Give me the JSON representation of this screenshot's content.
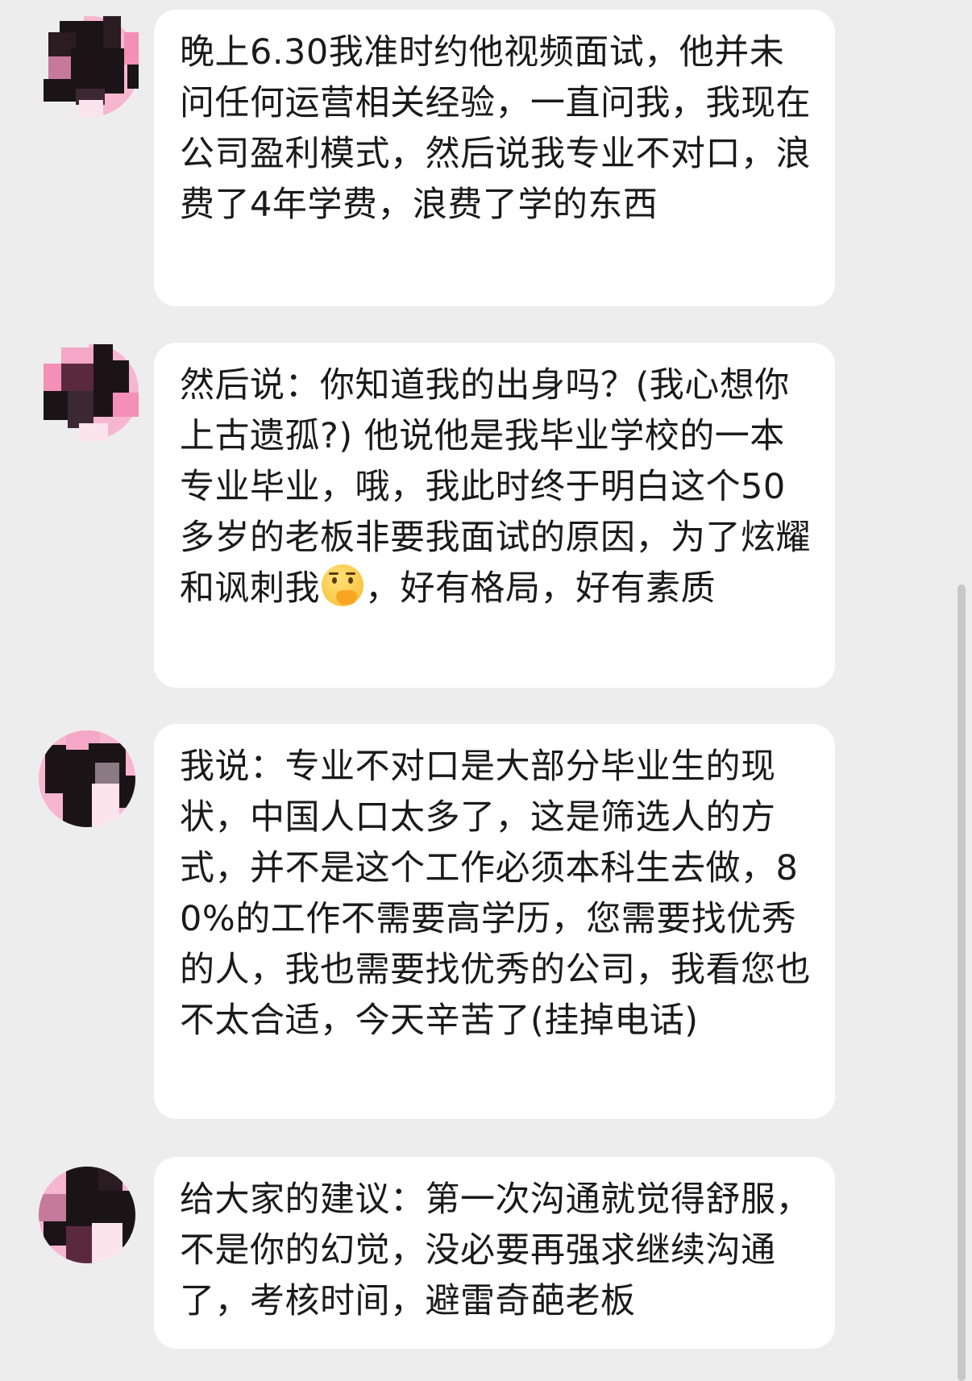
{
  "messages": [
    {
      "part1": "晚上6.30我准时约他视频面试，他并未问任何运营相关经验，一直问我，我现在公司盈利模式，然后说我专业不对口，浪费了4年学费，浪费了学的东西"
    },
    {
      "part1": "然后说：你知道我的出身吗？(我心想你上古遗孤?) 他说他是我毕业学校的一本专业毕业，哦，我此时终于明白这个50多岁的老板非要我面试的原因，为了炫耀和讽刺我",
      "emoji": "thinking-face-emoji",
      "part2": "，好有格局，好有素质"
    },
    {
      "part1": "我说：专业不对口是大部分毕业生的现状，中国人口太多了，这是筛选人的方式，并不是这个工作必须本科生去做，80%的工作不需要高学历，您需要找优秀的人，我也需要找优秀的公司，我看您也不太合适，今天辛苦了(挂掉电话)"
    },
    {
      "part1": "给大家的建议：第一次沟通就觉得舒服，不是你的幻觉，没必要再强求继续沟通了，考核时间，避雷奇葩老板"
    }
  ],
  "colors": {
    "background": "#ededed",
    "bubble": "#ffffff",
    "text": "#1a1a1a",
    "avatar_pink": "#f48fb8",
    "avatar_dark": "#1b1416"
  }
}
